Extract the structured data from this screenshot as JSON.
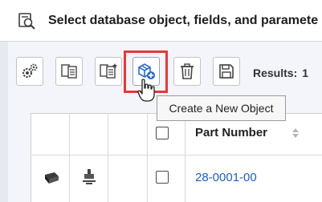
{
  "header": {
    "title": "Select database object, fields, and paramete",
    "icon": "database-search-icon"
  },
  "toolbar": {
    "buttons": [
      {
        "icon": "settings-gears-icon"
      },
      {
        "icon": "copy-fields-icon"
      },
      {
        "icon": "edit-fields-icon"
      },
      {
        "icon": "create-object-icon"
      },
      {
        "icon": "delete-icon"
      },
      {
        "icon": "save-icon"
      }
    ],
    "results_label": "Results:",
    "results_count": "1"
  },
  "tooltip": {
    "text": "Create a New Object"
  },
  "grid": {
    "columns": [
      {
        "label": ""
      },
      {
        "label": ""
      },
      {
        "label": ""
      },
      {
        "label": "Part Number"
      }
    ],
    "rows": [
      {
        "part_number": "28-0001-00"
      }
    ]
  },
  "colors": {
    "highlight": "#e53935",
    "link": "#1f5fb4",
    "accent_blue": "#2b6cc4"
  }
}
